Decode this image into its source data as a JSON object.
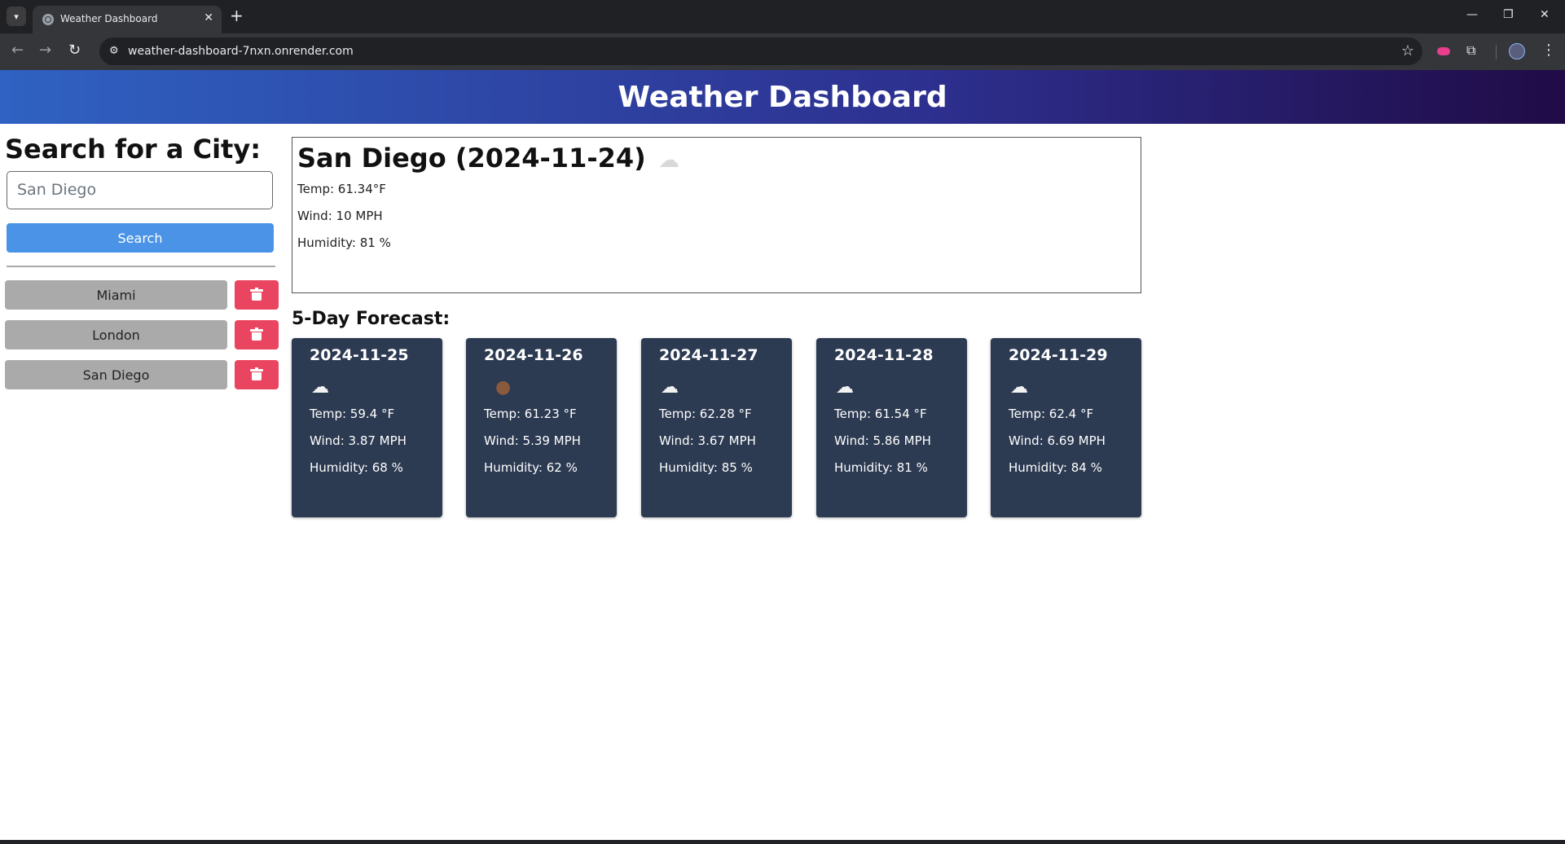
{
  "browser": {
    "tab_title": "Weather Dashboard",
    "url": "weather-dashboard-7nxn.onrender.com"
  },
  "page": {
    "header_title": "Weather Dashboard",
    "sidebar": {
      "title": "Search for a City:",
      "search_placeholder": "San Diego",
      "search_button": "Search",
      "cities": [
        "Miami",
        "London",
        "San Diego"
      ]
    },
    "current": {
      "title": "San Diego (2024-11-24)",
      "icon": "cloud-icon",
      "temp": "Temp: 61.34°F",
      "wind": "Wind: 10 MPH",
      "humidity": "Humidity: 81 %"
    },
    "forecast_title": "5-Day Forecast:",
    "forecast": [
      {
        "date": "2024-11-25",
        "icon": "cloud-icon",
        "temp": "Temp: 59.4 °F",
        "wind": "Wind: 3.87 MPH",
        "humidity": "Humidity: 68 %"
      },
      {
        "date": "2024-11-26",
        "icon": "moon-icon",
        "temp": "Temp: 61.23 °F",
        "wind": "Wind: 5.39 MPH",
        "humidity": "Humidity: 62 %"
      },
      {
        "date": "2024-11-27",
        "icon": "cloud-icon",
        "temp": "Temp: 62.28 °F",
        "wind": "Wind: 3.67 MPH",
        "humidity": "Humidity: 85 %"
      },
      {
        "date": "2024-11-28",
        "icon": "cloud-icon",
        "temp": "Temp: 61.54 °F",
        "wind": "Wind: 5.86 MPH",
        "humidity": "Humidity: 81 %"
      },
      {
        "date": "2024-11-29",
        "icon": "cloud-icon",
        "temp": "Temp: 62.4 °F",
        "wind": "Wind: 6.69 MPH",
        "humidity": "Humidity: 84 %"
      }
    ]
  },
  "colors": {
    "header_gradient_start": "#2f62c2",
    "header_gradient_end": "#200b46",
    "search_button": "#4a93e6",
    "city_button": "#aaaaaa",
    "delete_button": "#e94560",
    "forecast_card": "#2c3a52"
  }
}
